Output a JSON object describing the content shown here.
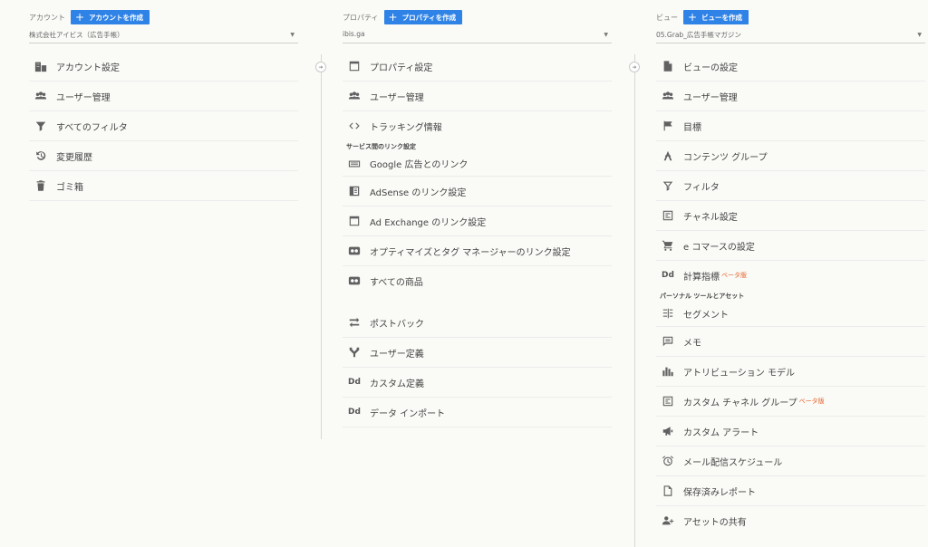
{
  "account": {
    "label": "アカウント",
    "create_label": "アカウントを作成",
    "selected": "株式会社アイビス（広告手帳）",
    "items": [
      {
        "label": "アカウント設定"
      },
      {
        "label": "ユーザー管理"
      },
      {
        "label": "すべてのフィルタ"
      },
      {
        "label": "変更履歴"
      },
      {
        "label": "ゴミ箱"
      }
    ]
  },
  "property": {
    "label": "プロパティ",
    "create_label": "プロパティを作成",
    "selected": "ibis.ga",
    "items_top": [
      {
        "label": "プロパティ設定"
      },
      {
        "label": "ユーザー管理"
      },
      {
        "label": "トラッキング情報"
      }
    ],
    "section_links": "サービス間のリンク設定",
    "link_items": [
      {
        "label": "Google 広告とのリンク"
      },
      {
        "label": "AdSense のリンク設定"
      },
      {
        "label": "Ad Exchange のリンク設定"
      },
      {
        "label": "オプティマイズとタグ マネージャーのリンク設定"
      },
      {
        "label": "すべての商品"
      }
    ],
    "other_items": [
      {
        "label": "ポストバック"
      },
      {
        "label": "ユーザー定義"
      },
      {
        "label": "カスタム定義",
        "icon_text": "Dd"
      },
      {
        "label": "データ インポート",
        "icon_text": "Dd"
      }
    ]
  },
  "view": {
    "label": "ビュー",
    "create_label": "ビューを作成",
    "selected": "05.Grab_広告手帳マガジン",
    "items_top": [
      {
        "label": "ビューの設定"
      },
      {
        "label": "ユーザー管理"
      },
      {
        "label": "目標"
      },
      {
        "label": "コンテンツ グループ"
      },
      {
        "label": "フィルタ"
      },
      {
        "label": "チャネル設定"
      },
      {
        "label": "e コマースの設定"
      },
      {
        "label": "計算指標",
        "beta": "ベータ版",
        "icon_text": "Dd"
      }
    ],
    "section_personal": "パーソナル ツールとアセット",
    "personal_items": [
      {
        "label": "セグメント"
      },
      {
        "label": "メモ"
      },
      {
        "label": "アトリビューション モデル"
      },
      {
        "label": "カスタム チャネル グループ",
        "beta": "ベータ版"
      },
      {
        "label": "カスタム アラート"
      },
      {
        "label": "メール配信スケジュール"
      },
      {
        "label": "保存済みレポート"
      },
      {
        "label": "アセットの共有"
      }
    ]
  },
  "colors": {
    "accent": "#2f83e6",
    "beta": "#e8642a"
  }
}
